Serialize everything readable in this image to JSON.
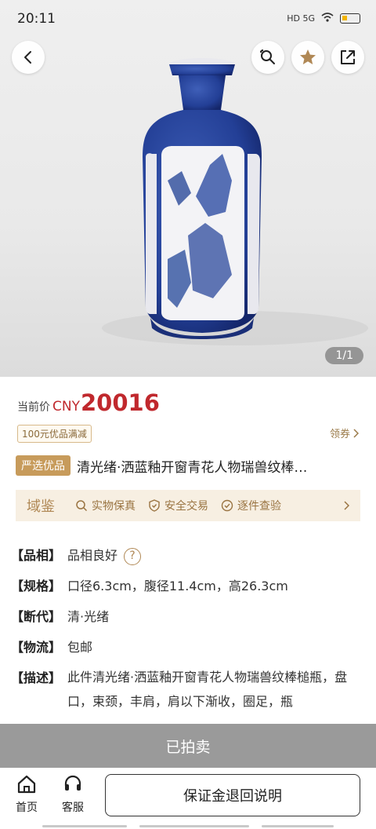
{
  "status_bar": {
    "time": "20:11",
    "net": "HD 5G"
  },
  "gallery": {
    "page_indicator": "1/1"
  },
  "price": {
    "label": "当前价",
    "currency": "CNY",
    "value": "20016"
  },
  "coupon": {
    "label": "100元优品满减",
    "get_label": "领券"
  },
  "title": {
    "badge": "严选优品",
    "text": "清光绪·洒蓝釉开窗青花人物瑞兽纹棒…"
  },
  "guarantee": {
    "brand": "域鉴",
    "items": [
      {
        "label": "实物保真",
        "icon": "search-icon"
      },
      {
        "label": "安全交易",
        "icon": "shield-icon"
      },
      {
        "label": "逐件查验",
        "icon": "check-circle-icon"
      }
    ]
  },
  "specs": [
    {
      "key": "【品相】",
      "value": "品相良好"
    },
    {
      "key": "【规格】",
      "value": "口径6.3cm，腹径11.4cm，高26.3cm"
    },
    {
      "key": "【断代】",
      "value": "清·光绪"
    },
    {
      "key": "【物流】",
      "value": "包邮"
    },
    {
      "key": "【描述】",
      "value": "此件清光绪·洒蓝釉开窗青花人物瑞兽纹棒槌瓶，盘口，束颈，丰肩，肩以下渐收，圈足，瓶"
    }
  ],
  "sold_label": "已拍卖",
  "bottom_nav": {
    "home_label": "首页",
    "service_label": "客服",
    "deposit_label": "保证金退回说明"
  },
  "colors": {
    "price_red": "#c0282d",
    "gold": "#c79b5b",
    "sold_gray": "#9a9a9a"
  }
}
